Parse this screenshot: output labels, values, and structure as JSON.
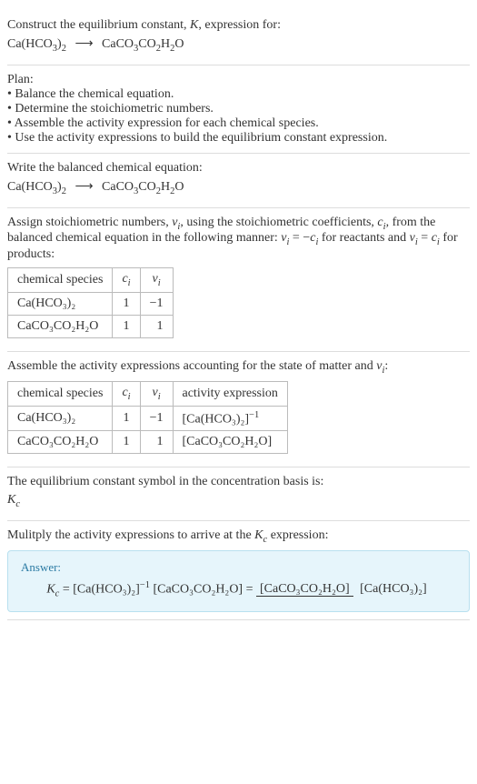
{
  "sec1": {
    "line1a": "Construct the equilibrium constant, ",
    "line1b": "K",
    "line1c": ", expression for:",
    "eq_lhs": "Ca(HCO",
    "eq_sub1": "3",
    "eq_rpar": ")",
    "eq_sub2": "2",
    "arrow": "⟶",
    "eq_rhs1": "CaCO",
    "eq_rhs_sub3": "3",
    "eq_rhs2": "CO",
    "eq_rhs_sub2": "2",
    "eq_rhs3": "H",
    "eq_rhs_sub2b": "2",
    "eq_rhs4": "O"
  },
  "sec2": {
    "plan": "Plan:",
    "b1": "• Balance the chemical equation.",
    "b2": "• Determine the stoichiometric numbers.",
    "b3": "• Assemble the activity expression for each chemical species.",
    "b4": "• Use the activity expressions to build the equilibrium constant expression."
  },
  "sec3": {
    "line": "Write the balanced chemical equation:"
  },
  "sec4": {
    "text_a": "Assign stoichiometric numbers, ",
    "nu": "ν",
    "sub_i": "i",
    "text_b": ", using the stoichiometric coefficients, ",
    "c": "c",
    "text_c": ", from the balanced chemical equation in the following manner: ",
    "eq1a": "ν",
    "eq1b": " = −",
    "eq1c": "c",
    "text_d": " for reactants and ",
    "eq2b": " = ",
    "text_e": " for products:",
    "th1": "chemical species",
    "th2": "c",
    "th3": "ν",
    "tbl": {
      "r1": {
        "s": "Ca(HCO₃)₂",
        "c": "1",
        "n": "−1"
      },
      "r2": {
        "s": "CaCO₃CO₂H₂O",
        "c": "1",
        "n": "1"
      }
    }
  },
  "sec5": {
    "text_a": "Assemble the activity expressions accounting for the state of matter and ",
    "colon": ":",
    "th1": "chemical species",
    "th4": "activity expression",
    "tbl": {
      "r1": {
        "s": "Ca(HCO₃)₂",
        "c": "1",
        "n": "−1",
        "a_open": "[Ca(HCO",
        "a_close": "]",
        "exp": "−1"
      },
      "r2": {
        "s": "CaCO₃CO₂H₂O",
        "c": "1",
        "n": "1",
        "a": "[CaCO₃CO₂H₂O]"
      }
    }
  },
  "sec6": {
    "text": "The equilibrium constant symbol in the concentration basis is:",
    "sym": "K",
    "sub": "c"
  },
  "sec7": {
    "text_a": "Mulitply the activity expressions to arrive at the ",
    "text_b": " expression:"
  },
  "answer": {
    "label": "Answer:",
    "lhs_K": "K",
    "lhs_sub": "c",
    "eq": " = ",
    "t1": "[Ca(HCO₃)₂]",
    "exp": "−1",
    "t2": " [CaCO₃CO₂H₂O] = ",
    "num": "[CaCO₃CO₂H₂O]",
    "den": "[Ca(HCO₃)₂]"
  }
}
